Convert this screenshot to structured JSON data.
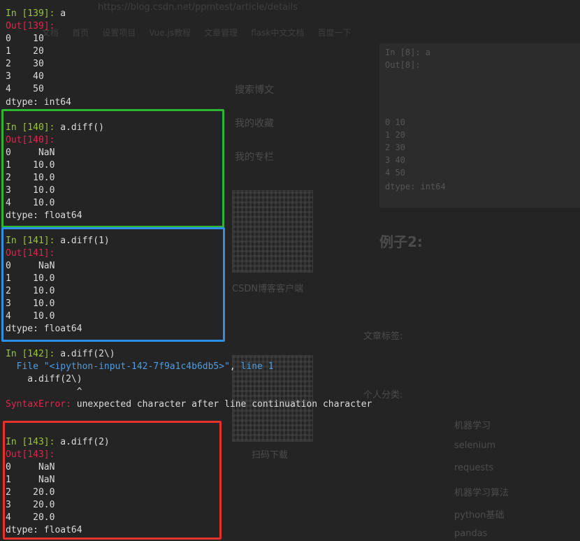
{
  "background_page": {
    "url": "https://blog.csdn.net/ppmtest/article/details",
    "bookmarks": [
      "文档",
      "首页",
      "设置项目",
      "Vue.js教程",
      "文章管理",
      "flask中文文档",
      "百度一下"
    ],
    "sidebar_links": [
      "搜索博文",
      "我的收藏",
      "我的专栏"
    ],
    "qr_caption": "CSDN博客客户端",
    "qr2_caption": "扫码下载",
    "section_title": "例子2:",
    "article_label": "文章标签:",
    "column_label": "个人分类:",
    "categories": [
      "机器学习",
      "selenium",
      "requests",
      "机器学习算法",
      "python基础",
      "pandas"
    ],
    "code_preview": [
      "In [8]: a",
      "Out[8]:",
      "0    10",
      "1    20",
      "2    30",
      "3    40",
      "4    50",
      "dtype: int64"
    ]
  },
  "terminal": {
    "cells": [
      {
        "in_prompt": "In [139]: ",
        "in_code": "a",
        "out_prompt": "Out[139]:",
        "rows": [
          "0    10",
          "1    20",
          "2    30",
          "3    40",
          "4    50"
        ],
        "dtype": "dtype: int64"
      },
      {
        "in_prompt": "In [140]: ",
        "in_code": "a.diff()",
        "out_prompt": "Out[140]:",
        "rows": [
          "0     NaN",
          "1    10.0",
          "2    10.0",
          "3    10.0",
          "4    10.0"
        ],
        "dtype": "dtype: float64"
      },
      {
        "in_prompt": "In [141]: ",
        "in_code": "a.diff(1)",
        "out_prompt": "Out[141]:",
        "rows": [
          "0     NaN",
          "1    10.0",
          "2    10.0",
          "3    10.0",
          "4    10.0"
        ],
        "dtype": "dtype: float64"
      },
      {
        "in_prompt": "In [142]: ",
        "in_code": "a.diff(2\\)",
        "traceback": {
          "file_prefix": "  File ",
          "file_name": "\"<ipython-input-142-7f9a1c4b6db5>\"",
          "line_sep": ", ",
          "line_label": "line 1",
          "code_line": "    a.diff(2\\)",
          "caret": "             ^",
          "error_type": "SyntaxError:",
          "error_msg": " unexpected character after line continuation character"
        }
      },
      {
        "in_prompt": "In [143]: ",
        "in_code": "a.diff(2)",
        "out_prompt": "Out[143]:",
        "rows": [
          "0     NaN",
          "1     NaN",
          "2    20.0",
          "3    20.0",
          "4    20.0"
        ],
        "dtype": "dtype: float64"
      }
    ]
  },
  "highlight_colors": {
    "green": "#2fb52f",
    "blue": "#2d8fe6",
    "red": "#e3332a"
  }
}
